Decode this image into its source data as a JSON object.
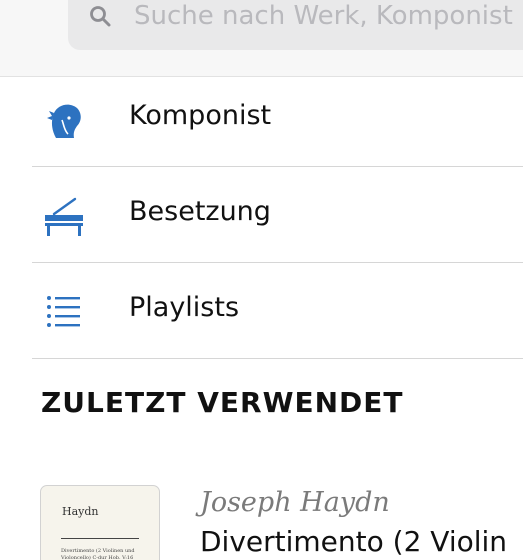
{
  "search": {
    "placeholder": "Suche nach Werk, Komponist"
  },
  "menu": {
    "items": [
      {
        "label": "Komponist",
        "icon": "composer-bust-icon"
      },
      {
        "label": "Besetzung",
        "icon": "grand-piano-icon"
      },
      {
        "label": "Playlists",
        "icon": "list-icon"
      }
    ]
  },
  "recent": {
    "title": "ZULETZT VERWENDET",
    "items": [
      {
        "composer": "Joseph Haydn",
        "work": "Divertimento (2 Violin",
        "thumb_title": "Haydn",
        "thumb_text": "Divertimento (2 Violinen und Violoncello) C-dur Hob. V:16"
      }
    ]
  },
  "colors": {
    "accent": "#2d72c0",
    "placeholder": "#b9b9bd",
    "divider": "#d6d6d6"
  }
}
